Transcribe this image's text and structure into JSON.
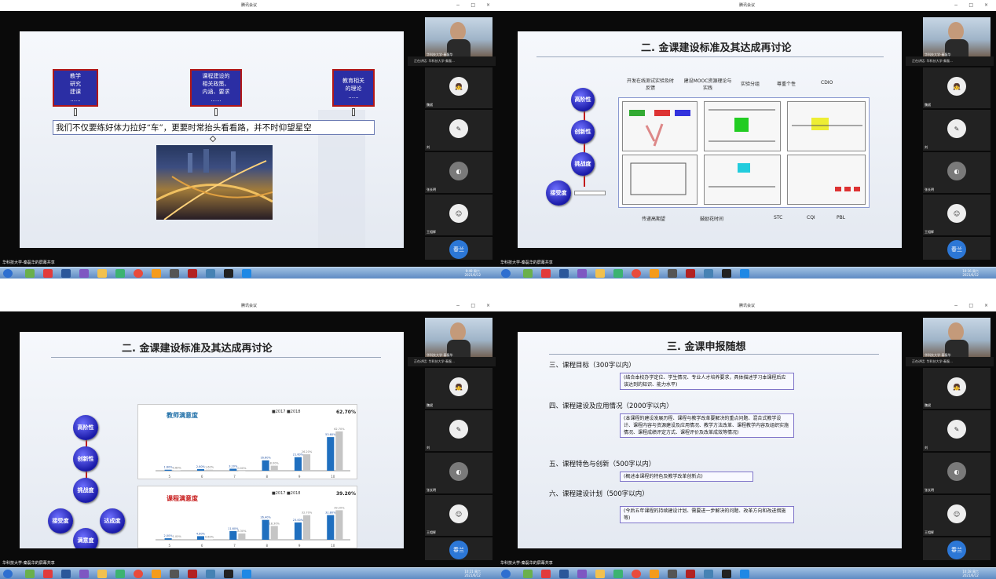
{
  "app_title": "腾讯会议",
  "window_controls": "− □ ×",
  "share_label": "华科技大学-秦磊华的屏幕共享",
  "speaking_label": "正在讲话: 华科技大学-秦磊...",
  "presenter_name": "华科技大学-秦磊华",
  "participants": [
    {
      "name": "魏斌"
    },
    {
      "name": "刘"
    },
    {
      "name": "张长明"
    },
    {
      "name": "王相辉"
    },
    {
      "name": "赵斯仁",
      "avatar": "春兰"
    }
  ],
  "clocks": [
    {
      "time": "9:49 周六",
      "date": "2021/6/12"
    },
    {
      "time": "10:16 周六",
      "date": "2021/6/12"
    },
    {
      "time": "10:21 周六",
      "date": "2021/6/12"
    },
    {
      "time": "10:28 周六",
      "date": "2021/6/12"
    }
  ],
  "slide1": {
    "box_left": [
      "教学",
      "研究",
      "建课",
      "......"
    ],
    "box_mid": [
      "课程建设的",
      "相关政策、",
      "内涵、要求",
      "......"
    ],
    "box_right": [
      "教育相关",
      "的理论",
      "......"
    ],
    "main_line": "我们不仅要练好体力拉好“车”，更要时常抬头看看路，并不时仰望星空"
  },
  "slide2": {
    "title": "二. 金课建设标准及其达成再讨论",
    "balls": [
      "高阶性",
      "创新性",
      "挑战度",
      "接受度"
    ],
    "top_labels": [
      "开发在线测试实验及时反馈",
      "建设MOOC资源理论与实践",
      "实验分组",
      "尊重个性",
      "CDIO"
    ],
    "bottom_labels": [
      "传递高期望",
      "鼓励花时间",
      "STC",
      "CQI",
      "PBL"
    ]
  },
  "slide3": {
    "title": "二. 金课建设标准及其达成再讨论",
    "balls": [
      "高阶性",
      "创新性",
      "挑战度",
      "接受度",
      "达成度",
      "满意度"
    ],
    "legend": "■2017 ■2018",
    "chart_data": [
      {
        "type": "bar",
        "title": "教师满意度",
        "categories": [
          "5",
          "6",
          "7",
          "8",
          "9",
          "10"
        ],
        "series": [
          {
            "name": "2017",
            "values": [
              1.6,
              2.6,
              3.2,
              16.6,
              21.6,
              53.6
            ]
          },
          {
            "name": "2018",
            "values": [
              0.6,
              1.6,
              0,
              8.0,
              26.2,
              62.7
            ]
          }
        ],
        "ylim": [
          0,
          80
        ],
        "highlight": "62.70%"
      },
      {
        "type": "bar",
        "title": "课程满意度",
        "categories": [
          "5",
          "6",
          "7",
          "8",
          "9",
          "10"
        ],
        "series": [
          {
            "name": "2017",
            "values": [
              2.0,
              4.8,
              11.6,
              26.4,
              23.0,
              32.8
            ]
          },
          {
            "name": "2018",
            "values": [
              1.0,
              0.6,
              8.3,
              18.3,
              32.7,
              39.2
            ]
          }
        ],
        "ylim": [
          0,
          50
        ],
        "highlight": "39.20%"
      }
    ]
  },
  "slide4": {
    "title": "三. 金课申报随想",
    "sections": [
      {
        "head": "三、课程目标（300字以内）",
        "note": "(结合本校办学定位、学生情况、专业人才培养要求，具体描述学习本课程后应该达到的知识、能力水平)"
      },
      {
        "head": "四、课程建设及应用情况（2000字以内）",
        "note": "(本课程的建设发展历程、课程与教学改革要解决的重点问题、混合式教学设计、课程内容与资源建设及应用情况、教学方法改革、课程教学内容及组织实施情况、课程成绩评定方式、课程评价及改革成效等情况)"
      },
      {
        "head": "五、课程特色与创新（500字以内）",
        "note": "(概述本课程的特色及教学改革创新点)"
      },
      {
        "head": "六、课程建设计划（500字以内）",
        "note": "(今后五年课程的持续建设计划、需要进一步解决的问题、改革方向和改进措施等)"
      }
    ]
  }
}
